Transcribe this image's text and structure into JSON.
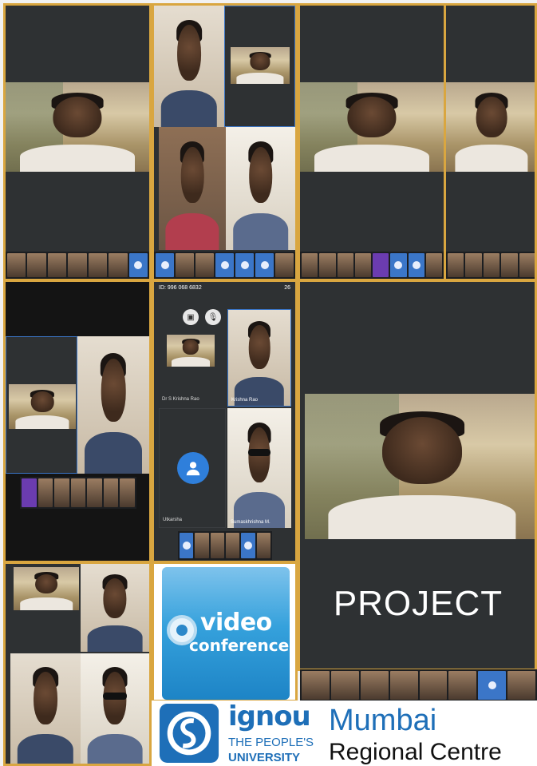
{
  "call": {
    "meeting_id": "ID: 996 068 6832",
    "status_time": "26",
    "participant_1": "Dr S Krishna Rao",
    "participant_2": "Krishna Rao",
    "participant_3": "Utkarsha",
    "participant_4": "Sumaskhrishna M."
  },
  "tile": {
    "video_word": "video",
    "conference_word": "conference"
  },
  "project_label": "PROJECT",
  "footer": {
    "ignou": "ignou",
    "peoples": "THE PEOPLE'S",
    "university": "UNIVERSITY",
    "mumbai": "Mumbai",
    "regional": "Regional Centre"
  },
  "colors": {
    "frame": "#d9a640",
    "panel": "#2e3133",
    "brand_blue": "#1e6fb8",
    "end_call_red": "#e53935"
  },
  "icons": [
    "camera-off-icon",
    "mic-off-icon",
    "more-icon",
    "end-call-icon",
    "user-avatar-icon",
    "ignou-logo-icon",
    "webcam-icon"
  ]
}
